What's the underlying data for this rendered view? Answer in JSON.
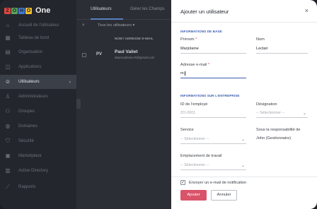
{
  "app": {
    "logo_letters": [
      "Z",
      "O",
      "H",
      "O"
    ],
    "logo_colors": [
      "#e2453c",
      "#5aa55b",
      "#3d7ad6",
      "#f2bf2e"
    ],
    "name": "One"
  },
  "sidebar": {
    "items": [
      {
        "label": "Accueil de l'utilisateur",
        "icon": "home-icon"
      },
      {
        "label": "Tableau de bord",
        "icon": "dashboard-icon"
      },
      {
        "label": "Organisation",
        "icon": "organization-icon"
      },
      {
        "label": "Applications",
        "icon": "apps-icon"
      },
      {
        "label": "Utilisateurs",
        "icon": "users-icon",
        "active": true
      },
      {
        "label": "Administrateurs",
        "icon": "admin-icon"
      },
      {
        "label": "Groupes",
        "icon": "groups-icon"
      },
      {
        "label": "Domaines",
        "icon": "domains-icon"
      },
      {
        "label": "Sécurité",
        "icon": "shield-icon"
      },
      {
        "label": "Marketplace",
        "icon": "marketplace-icon"
      },
      {
        "label": "Active Directory",
        "icon": "directory-icon"
      },
      {
        "label": "Rapports",
        "icon": "reports-icon"
      }
    ]
  },
  "main": {
    "tabs": [
      "Utilisateurs",
      "Gérer les Champs"
    ],
    "filter_label": "Tous les utilisateurs",
    "table_header": "NOM / ADRESSE E-MAIL",
    "row": {
      "avatar": "PV",
      "name": "Paul Valiet",
      "email": "deprocalsson.R@gmail.com"
    }
  },
  "dialog": {
    "title": "Ajouter un utilisateur",
    "close_glyph": "×",
    "section_basic": "INFORMATIONS DE BASE",
    "first_name_label": "Prénom",
    "first_name_value": "Marjolaine",
    "last_name_label": "Nom",
    "last_name_value": "Leclair",
    "email_label": "Adresse e-mail",
    "email_value": "m",
    "required_mark": "*",
    "section_company": "INFORMATIONS SUR L'ENTREPRISE",
    "employee_id_label": "ID de l'employé",
    "employee_id_placeholder": "ZO-0001",
    "designation_label": "Désignation",
    "designation_placeholder": "-- Sélectionner --",
    "department_label": "Service",
    "department_placeholder": "-- Sélectionner --",
    "manager_label": "Sous la responsabilité de",
    "manager_value": "John (Gestionnaire)",
    "location_label": "Emplacement de travail",
    "location_placeholder": "-- Sélectionner --",
    "notify_checked": true,
    "notify_label": "Envoyer un e-mail de notification",
    "add_button": "Ajouter",
    "cancel_button": "Annuler"
  },
  "colors": {
    "accent": "#3b5cb0",
    "primary_button": "#d9536a",
    "required": "#e0435b"
  }
}
